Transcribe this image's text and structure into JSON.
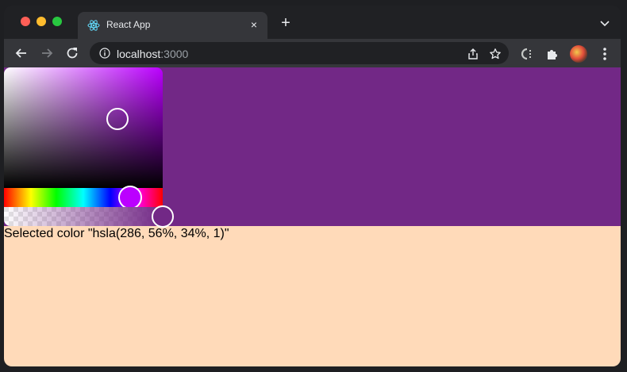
{
  "browser": {
    "tab": {
      "title": "React App",
      "favicon": "react-logo-icon",
      "close_label": "×"
    },
    "new_tab_label": "+",
    "address_bar": {
      "host": "localhost",
      "port": ":3000"
    },
    "toolbar_icons": [
      "back-arrow-icon",
      "forward-arrow-icon",
      "reload-icon",
      "info-icon",
      "share-icon",
      "bookmark-star-icon",
      "extension-c-icon",
      "puzzle-extensions-icon",
      "profile-avatar",
      "menu-dots-icon"
    ]
  },
  "colors": {
    "selected": "#722886",
    "picker_hue": "#bb00ff",
    "page_background": "#ffdab9"
  },
  "picker": {
    "hue": 286,
    "saturation": 56,
    "lightness": 34,
    "alpha": 1
  },
  "page": {
    "caption": "Selected color \"hsla(286, 56%, 34%, 1)\""
  }
}
